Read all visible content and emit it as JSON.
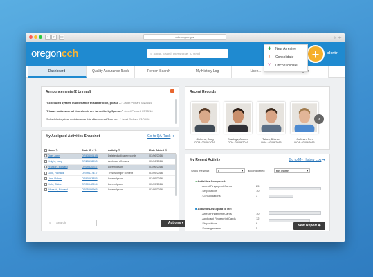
{
  "browser": {
    "url": "cch.oregon.gov"
  },
  "app": {
    "logo_a": "oregon",
    "logo_b": "cch",
    "search_placeholder": "Smart Search press enter to send",
    "user_label": "olent▾"
  },
  "quick_menu": {
    "items": [
      {
        "label": "New Arrestee",
        "icon": "person-add-icon"
      },
      {
        "label": "Consolidate",
        "icon": "merge-icon"
      },
      {
        "label": "Unconsolidate",
        "icon": "split-icon"
      }
    ]
  },
  "tabs": [
    {
      "label": "Dashboard",
      "active": true
    },
    {
      "label": "Quality Assurance Rack"
    },
    {
      "label": "Person Search"
    },
    {
      "label": "My History Log"
    },
    {
      "label": "Licen..."
    },
    {
      "label": "...gum"
    }
  ],
  "announcements": {
    "title": "Announcements (2 Unread)",
    "items": [
      {
        "text": "\"Scheduled system maintenance this afternoon, please ...\"",
        "author": "Janet Pichard",
        "date": "03/06/16"
      },
      {
        "text": "\"Please make sure all timesheets are turned in by 5pm o...\"",
        "author": "Janet Pichard",
        "date": "03/05/16"
      },
      {
        "text": "\"Scheduled system maintenance this afternoon at 3pm, on...\"",
        "author": "Janet Pichard",
        "date": "03/05/16"
      }
    ]
  },
  "activities": {
    "title": "My Assigned Activities Snapshot",
    "link": "Go to QA Rack",
    "columns": [
      "Name",
      "State ID #",
      "Activity",
      "Date Added"
    ],
    "rows": [
      {
        "name": "Doe, John",
        "sid": "OR8340013B",
        "activity": "Delete duplicate records",
        "date": "03/06/2016",
        "checked": true,
        "selected": true
      },
      {
        "name": "Knight, Lucy",
        "sid": "OR23598950",
        "activity": "Add new offenses",
        "date": "03/06/2016",
        "checked": false,
        "selected": false
      },
      {
        "name": "Franklin, Edward",
        "sid": "OR09830787",
        "activity": "Lorem Ipsum",
        "date": "03/06/2016",
        "checked": true,
        "selected": true
      },
      {
        "name": "Gold, Richard",
        "sid": "OR49477447",
        "activity": "This is longer content",
        "date": "03/05/2016",
        "checked": false,
        "selected": false
      },
      {
        "name": "Linn, Robert",
        "sid": "OR90083355",
        "activity": "Lorem Ipsum",
        "date": "03/05/2016",
        "checked": false,
        "selected": false
      },
      {
        "name": "Kohl, Chloe",
        "sid": "OR30942894",
        "activity": "Lorem Ipsum",
        "date": "03/05/2016",
        "checked": false,
        "selected": false
      },
      {
        "name": "Wensch, Edward",
        "sid": "OR05096965",
        "activity": "Lorem Ipsum",
        "date": "03/05/2016",
        "checked": false,
        "selected": false
      }
    ],
    "search_placeholder": "Search",
    "actions_label": "Actions"
  },
  "recent_records": {
    "title": "Recent Records",
    "items": [
      {
        "name": "Gibbons, Craig",
        "dob": "DOA: 03/09/2016",
        "shirt": "#3f4a55",
        "skin": "#d9a98a",
        "hair": "#5a3b26"
      },
      {
        "name": "Rawlings, Andrew",
        "dob": "DOA: 03/09/2016",
        "shirt": "#2f2f35",
        "skin": "#c98f6c",
        "hair": "#2b1d15"
      },
      {
        "name": "Tatum, Brinnon",
        "dob": "DOA: 03/09/2016",
        "shirt": "#5b6f86",
        "skin": "#d8a485",
        "hair": "#3d2a1c"
      },
      {
        "name": "Coffman, Ron",
        "dob": "DOA: 03/09/2016",
        "shirt": "#4d8ad0",
        "skin": "#e2b597",
        "hair": "#a07a4c"
      }
    ]
  },
  "my_activity": {
    "title": "My Recent Activity",
    "link": "Go to My History Log",
    "show_label": "Show me what",
    "show_value": "I",
    "accomplished_label": "accomplished",
    "period_value": "this month",
    "completed": {
      "title": "Activities Completed:",
      "rows": [
        {
          "label": "- Arrest Fingerprint Cards",
          "value": "25"
        },
        {
          "label": "- Dispositions",
          "value": "10"
        },
        {
          "label": "- Consolidations",
          "value": "3"
        }
      ]
    },
    "assigned": {
      "title": "Activities Assigned to Me:",
      "rows": [
        {
          "label": "- Arrest Fingerprint Cards",
          "value": "10"
        },
        {
          "label": "- Applicant Fingerprint Cards",
          "value": "12"
        },
        {
          "label": "- Dispositions",
          "value": "9"
        },
        {
          "label": "- Expungements",
          "value": "5"
        }
      ]
    },
    "new_report_label": "New Report"
  },
  "colors": {
    "brand": "#1f8ad0",
    "accent": "#f6b02b",
    "dark_button": "#3d3d3d"
  }
}
